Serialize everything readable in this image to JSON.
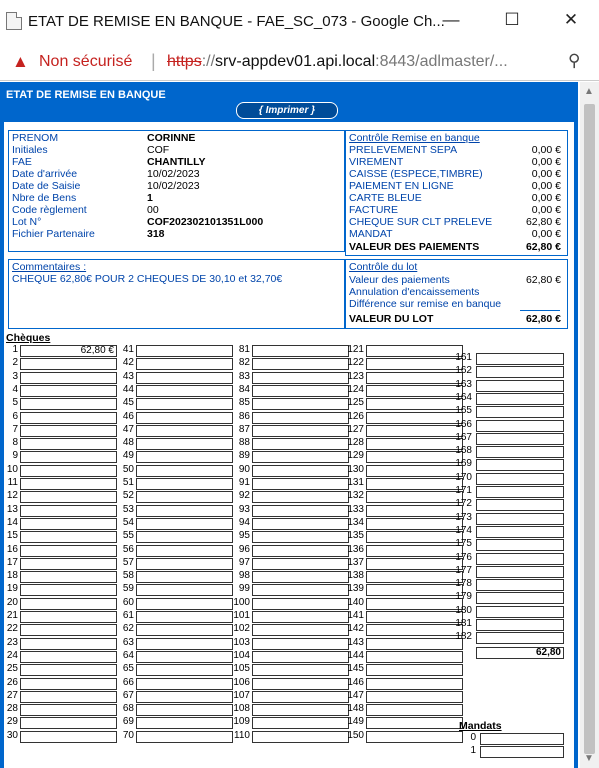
{
  "window": {
    "title": "ETAT DE REMISE EN BANQUE - FAE_SC_073 - Google Ch...",
    "minimize": "—",
    "maximize": "☐",
    "close": "✕"
  },
  "urlbar": {
    "warning_icon": "▲",
    "security": "Non sécurisé",
    "separator": "|",
    "url_scheme": "https",
    "url_sep": "://",
    "url_host": "srv-appdev01.api.local",
    "url_rest": ":8443/adlmaster/...",
    "zoom_icon": "⚲"
  },
  "form": {
    "header": "ETAT DE REMISE EN BANQUE",
    "print_label": "{ Imprimer }",
    "info": {
      "labels": [
        "PRENOM",
        "Initiales",
        "FAE",
        "Date d'arrivée",
        "Date de Saisie",
        "Nbre de Bens",
        "Code règlement",
        "Lot N°",
        "Fichier Partenaire"
      ],
      "values": [
        "CORINNE",
        "COF",
        "CHANTILLY",
        "10/02/2023",
        "10/02/2023",
        "1",
        "00",
        "COF202302101351L000",
        "318"
      ]
    },
    "controle_remise": {
      "title": "Contrôle Remise en banque",
      "rows": [
        {
          "label": "PRELEVEMENT SEPA",
          "amount": "0,00 €"
        },
        {
          "label": "VIREMENT",
          "amount": "0,00 €"
        },
        {
          "label": "CAISSE (ESPECE,TIMBRE)",
          "amount": "0,00 €"
        },
        {
          "label": "PAIEMENT EN LIGNE",
          "amount": "0,00 €"
        },
        {
          "label": "CARTE BLEUE",
          "amount": "0,00 €"
        },
        {
          "label": "FACTURE",
          "amount": "0,00 €"
        },
        {
          "label": "CHEQUE SUR CLT PRELEVE",
          "amount": "62,80 €"
        },
        {
          "label": "MANDAT",
          "amount": "0,00 €"
        }
      ],
      "total_label": "VALEUR DES PAIEMENTS",
      "total_amount": "62,80 €"
    },
    "commentaires": {
      "title": "Commentaires :",
      "text": "CHEQUE 62,80€ POUR 2 CHEQUES DE 30,10 et 32,70€"
    },
    "controle_lot": {
      "title": "Contrôle du lot",
      "valeur_paiements_label": "Valeur des paiements",
      "valeur_paiements_amount": "62,80 €",
      "annulation_label": "Annulation d'encaissements",
      "difference_label": "Différence sur remise en banque",
      "total_label": "VALEUR DU LOT",
      "total_amount": "62,80 €"
    },
    "cheques": {
      "title": "Chèques",
      "first_value": "62,80 €",
      "col5_total": "62,80"
    },
    "mandats": {
      "title": "Mandats",
      "rows": [
        "0",
        "1"
      ]
    }
  }
}
